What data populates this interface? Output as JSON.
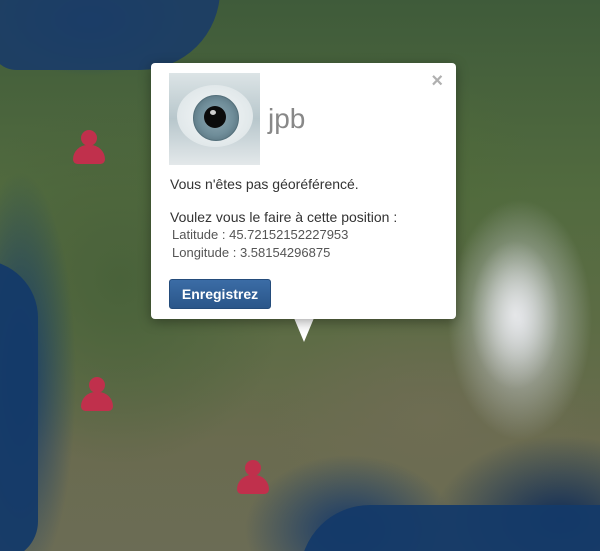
{
  "popup": {
    "username": "jpb",
    "message": "Vous n'êtes pas géoréférencé.",
    "prompt": "Voulez vous le faire à cette position :",
    "latitude_label": "Latitude : 45.72152152227953",
    "longitude_label": "Longitude : 3.58154296875",
    "save_button_label": "Enregistrez",
    "close_label": "×",
    "avatar_icon": "eye-photo"
  },
  "markers": {
    "icon": "user-icon",
    "color": "#c0304c",
    "count": 3
  },
  "colors": {
    "button": "#2f5f96",
    "marker": "#c0304c"
  }
}
